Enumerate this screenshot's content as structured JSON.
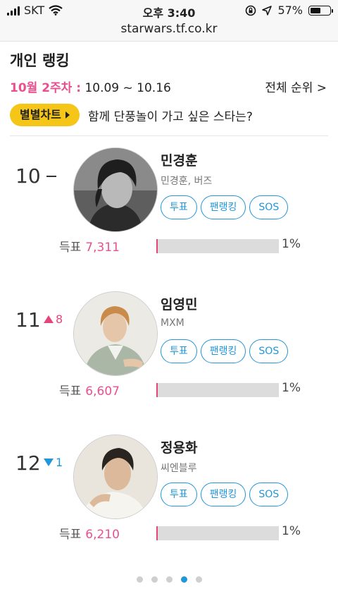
{
  "status_bar": {
    "carrier": "SKT",
    "time": "오후 3:40",
    "battery": "57%",
    "battery_level": 0.57
  },
  "url": "starwars.tf.co.kr",
  "header": {
    "title": "개인 랭킹",
    "week_label": "10월 2주차 :",
    "date_range": "10.09 ~ 10.16",
    "all_rank_link": "전체 순위 >"
  },
  "byul_chart": {
    "label": "별별차트",
    "question": "함께 단풍놀이 가고 싶은 스타는?"
  },
  "ranking": [
    {
      "rank": "10",
      "change_dir": "none",
      "change": "",
      "name": "민경훈",
      "group": "민경훈, 버즈",
      "buttons": [
        "투표",
        "팬랭킹",
        "SOS"
      ],
      "votes_label": "득표",
      "votes": "7,311",
      "percent": "1%",
      "percent_value": 0.01
    },
    {
      "rank": "11",
      "change_dir": "up",
      "change": "8",
      "name": "임영민",
      "group": "MXM",
      "buttons": [
        "투표",
        "팬랭킹",
        "SOS"
      ],
      "votes_label": "득표",
      "votes": "6,607",
      "percent": "1%",
      "percent_value": 0.01
    },
    {
      "rank": "12",
      "change_dir": "down",
      "change": "1",
      "name": "정용화",
      "group": "씨엔블루",
      "buttons": [
        "투표",
        "팬랭킹",
        "SOS"
      ],
      "votes_label": "득표",
      "votes": "6,210",
      "percent": "1%",
      "percent_value": 0.01
    }
  ],
  "pagination": {
    "total": 5,
    "active": 4
  },
  "colors": {
    "accent_pink": "#ea4f8f",
    "accent_blue": "#2196d9",
    "chart_yellow": "#f5c518"
  }
}
